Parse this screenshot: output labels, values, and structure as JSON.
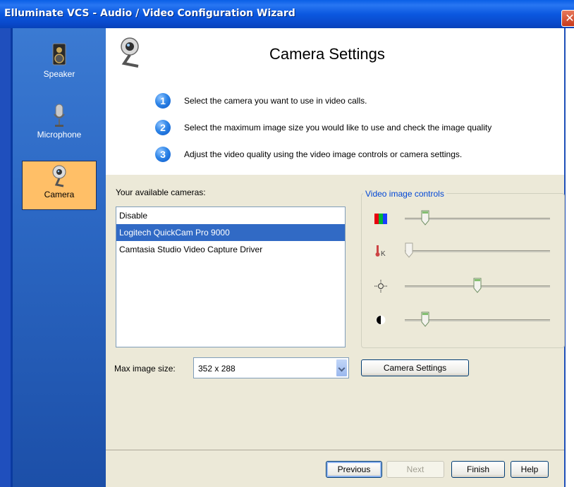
{
  "window": {
    "title": "Elluminate VCS - Audio / Video Configuration Wizard",
    "close_label": "✕"
  },
  "sidebar": {
    "items": [
      {
        "label": "Speaker",
        "icon": "speaker-icon"
      },
      {
        "label": "Microphone",
        "icon": "microphone-icon"
      },
      {
        "label": "Camera",
        "icon": "webcam-icon",
        "active": true
      }
    ]
  },
  "header": {
    "title": "Camera Settings",
    "steps": [
      {
        "num": "1",
        "text": "Select the camera you want to use in video calls."
      },
      {
        "num": "2",
        "text": "Select the maximum image size you would like to use and check the image quality"
      },
      {
        "num": "3",
        "text": "Adjust the video quality using the video image controls or camera settings."
      }
    ]
  },
  "cameras": {
    "label": "Your available cameras:",
    "items": [
      "Disable",
      "Logitech QuickCam Pro 9000",
      "Camtasia Studio Video Capture Driver"
    ],
    "selected": "Logitech QuickCam Pro 9000"
  },
  "image_size": {
    "label": "Max image size:",
    "value": "352 x 288"
  },
  "camera_settings_button": "Camera Settings",
  "video_controls": {
    "title": "Video image controls",
    "sliders": [
      {
        "name": "color",
        "icon": "rgb-color-icon",
        "level": 0.1
      },
      {
        "name": "white-balance",
        "icon": "thermometer-kelvin-icon",
        "level": 0.0
      },
      {
        "name": "brightness",
        "icon": "sun-brightness-icon",
        "level": 0.5
      },
      {
        "name": "contrast",
        "icon": "contrast-icon",
        "level": 0.1
      }
    ]
  },
  "footer": {
    "previous": "Previous",
    "next": "Next",
    "finish": "Finish",
    "help": "Help"
  },
  "colors": {
    "sidebar_active": "#ffbf67",
    "selection": "#316ac5",
    "group_title": "#0046d5",
    "titlebar": "#0b58e0"
  }
}
